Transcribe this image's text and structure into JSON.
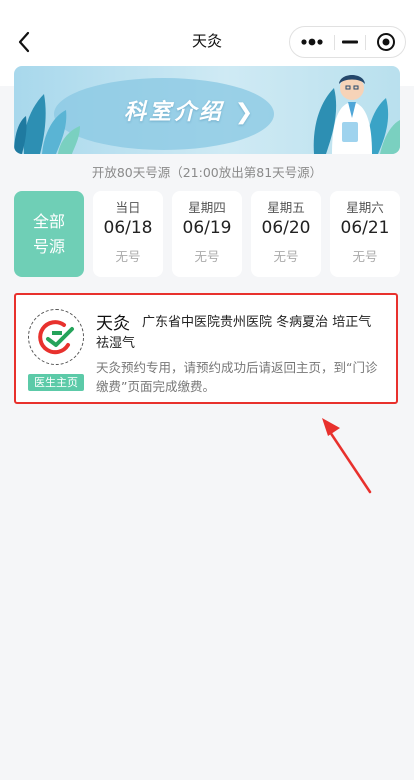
{
  "navbar": {
    "title": "天灸",
    "back_icon": "chevron-left-icon",
    "more_icon": "more-dots-icon",
    "minimize_icon": "minus-icon",
    "close_icon": "target-circle-icon"
  },
  "banner": {
    "text": "科室介绍",
    "arrow": "❯"
  },
  "info_line": "开放80天号源（21:00放出第81天号源）",
  "schedule": {
    "all_label_line1": "全部",
    "all_label_line2": "号源",
    "days": [
      {
        "week": "当日",
        "date": "06/18",
        "status": "无号"
      },
      {
        "week": "星期四",
        "date": "06/19",
        "status": "无号"
      },
      {
        "week": "星期五",
        "date": "06/20",
        "status": "无号"
      },
      {
        "week": "星期六",
        "date": "06/21",
        "status": "无号"
      }
    ]
  },
  "doctor": {
    "name": "天灸",
    "hospital": "广东省中医院贵州医院 冬病夏治 培正气 祛湿气",
    "description": "天灸预约专用，请预约成功后请返回主页，到“门诊缴费”页面完成缴费。",
    "tag": "医生主页",
    "accent_color": "#e8312d",
    "tag_color": "#5ccaa8"
  },
  "colors": {
    "primary": "#6fcfb6",
    "annotation_red": "#e8312d"
  }
}
